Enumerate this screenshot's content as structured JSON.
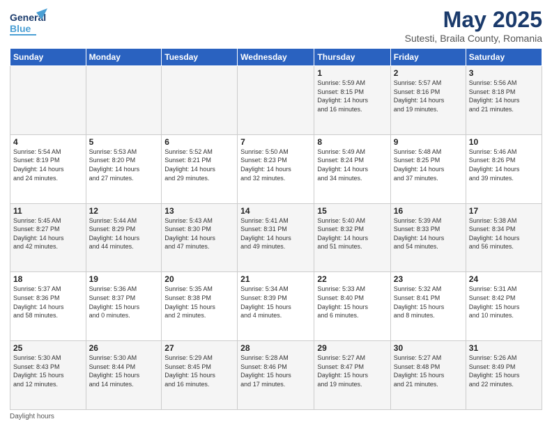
{
  "header": {
    "logo_line1": "General",
    "logo_line2": "Blue",
    "title": "May 2025",
    "subtitle": "Sutesti, Braila County, Romania"
  },
  "weekdays": [
    "Sunday",
    "Monday",
    "Tuesday",
    "Wednesday",
    "Thursday",
    "Friday",
    "Saturday"
  ],
  "weeks": [
    [
      {
        "day": "",
        "info": ""
      },
      {
        "day": "",
        "info": ""
      },
      {
        "day": "",
        "info": ""
      },
      {
        "day": "",
        "info": ""
      },
      {
        "day": "1",
        "info": "Sunrise: 5:59 AM\nSunset: 8:15 PM\nDaylight: 14 hours\nand 16 minutes."
      },
      {
        "day": "2",
        "info": "Sunrise: 5:57 AM\nSunset: 8:16 PM\nDaylight: 14 hours\nand 19 minutes."
      },
      {
        "day": "3",
        "info": "Sunrise: 5:56 AM\nSunset: 8:18 PM\nDaylight: 14 hours\nand 21 minutes."
      }
    ],
    [
      {
        "day": "4",
        "info": "Sunrise: 5:54 AM\nSunset: 8:19 PM\nDaylight: 14 hours\nand 24 minutes."
      },
      {
        "day": "5",
        "info": "Sunrise: 5:53 AM\nSunset: 8:20 PM\nDaylight: 14 hours\nand 27 minutes."
      },
      {
        "day": "6",
        "info": "Sunrise: 5:52 AM\nSunset: 8:21 PM\nDaylight: 14 hours\nand 29 minutes."
      },
      {
        "day": "7",
        "info": "Sunrise: 5:50 AM\nSunset: 8:23 PM\nDaylight: 14 hours\nand 32 minutes."
      },
      {
        "day": "8",
        "info": "Sunrise: 5:49 AM\nSunset: 8:24 PM\nDaylight: 14 hours\nand 34 minutes."
      },
      {
        "day": "9",
        "info": "Sunrise: 5:48 AM\nSunset: 8:25 PM\nDaylight: 14 hours\nand 37 minutes."
      },
      {
        "day": "10",
        "info": "Sunrise: 5:46 AM\nSunset: 8:26 PM\nDaylight: 14 hours\nand 39 minutes."
      }
    ],
    [
      {
        "day": "11",
        "info": "Sunrise: 5:45 AM\nSunset: 8:27 PM\nDaylight: 14 hours\nand 42 minutes."
      },
      {
        "day": "12",
        "info": "Sunrise: 5:44 AM\nSunset: 8:29 PM\nDaylight: 14 hours\nand 44 minutes."
      },
      {
        "day": "13",
        "info": "Sunrise: 5:43 AM\nSunset: 8:30 PM\nDaylight: 14 hours\nand 47 minutes."
      },
      {
        "day": "14",
        "info": "Sunrise: 5:41 AM\nSunset: 8:31 PM\nDaylight: 14 hours\nand 49 minutes."
      },
      {
        "day": "15",
        "info": "Sunrise: 5:40 AM\nSunset: 8:32 PM\nDaylight: 14 hours\nand 51 minutes."
      },
      {
        "day": "16",
        "info": "Sunrise: 5:39 AM\nSunset: 8:33 PM\nDaylight: 14 hours\nand 54 minutes."
      },
      {
        "day": "17",
        "info": "Sunrise: 5:38 AM\nSunset: 8:34 PM\nDaylight: 14 hours\nand 56 minutes."
      }
    ],
    [
      {
        "day": "18",
        "info": "Sunrise: 5:37 AM\nSunset: 8:36 PM\nDaylight: 14 hours\nand 58 minutes."
      },
      {
        "day": "19",
        "info": "Sunrise: 5:36 AM\nSunset: 8:37 PM\nDaylight: 15 hours\nand 0 minutes."
      },
      {
        "day": "20",
        "info": "Sunrise: 5:35 AM\nSunset: 8:38 PM\nDaylight: 15 hours\nand 2 minutes."
      },
      {
        "day": "21",
        "info": "Sunrise: 5:34 AM\nSunset: 8:39 PM\nDaylight: 15 hours\nand 4 minutes."
      },
      {
        "day": "22",
        "info": "Sunrise: 5:33 AM\nSunset: 8:40 PM\nDaylight: 15 hours\nand 6 minutes."
      },
      {
        "day": "23",
        "info": "Sunrise: 5:32 AM\nSunset: 8:41 PM\nDaylight: 15 hours\nand 8 minutes."
      },
      {
        "day": "24",
        "info": "Sunrise: 5:31 AM\nSunset: 8:42 PM\nDaylight: 15 hours\nand 10 minutes."
      }
    ],
    [
      {
        "day": "25",
        "info": "Sunrise: 5:30 AM\nSunset: 8:43 PM\nDaylight: 15 hours\nand 12 minutes."
      },
      {
        "day": "26",
        "info": "Sunrise: 5:30 AM\nSunset: 8:44 PM\nDaylight: 15 hours\nand 14 minutes."
      },
      {
        "day": "27",
        "info": "Sunrise: 5:29 AM\nSunset: 8:45 PM\nDaylight: 15 hours\nand 16 minutes."
      },
      {
        "day": "28",
        "info": "Sunrise: 5:28 AM\nSunset: 8:46 PM\nDaylight: 15 hours\nand 17 minutes."
      },
      {
        "day": "29",
        "info": "Sunrise: 5:27 AM\nSunset: 8:47 PM\nDaylight: 15 hours\nand 19 minutes."
      },
      {
        "day": "30",
        "info": "Sunrise: 5:27 AM\nSunset: 8:48 PM\nDaylight: 15 hours\nand 21 minutes."
      },
      {
        "day": "31",
        "info": "Sunrise: 5:26 AM\nSunset: 8:49 PM\nDaylight: 15 hours\nand 22 minutes."
      }
    ]
  ],
  "footer": {
    "note": "Daylight hours"
  }
}
